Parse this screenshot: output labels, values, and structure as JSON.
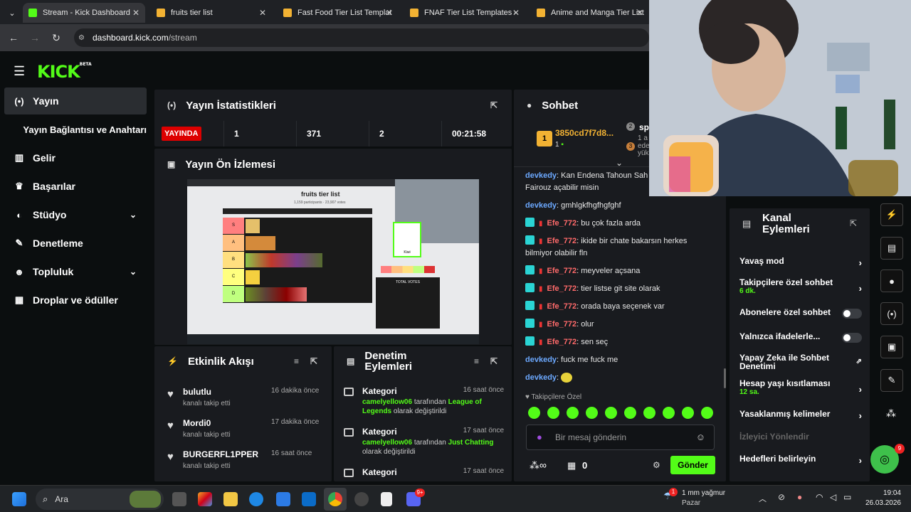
{
  "browser": {
    "tabs": [
      {
        "title": "Stream - Kick Dashboard",
        "active": true
      },
      {
        "title": "fruits tier list"
      },
      {
        "title": "Fast Food Tier List Templat"
      },
      {
        "title": "FNAF Tier List Templates -"
      },
      {
        "title": "Anime and Manga Tier List"
      }
    ],
    "url_domain": "dashboard.kick.com",
    "url_path": "/stream"
  },
  "brand": {
    "logo": "KICK",
    "beta": "BETA",
    "accent": "#53fc18"
  },
  "sidebar": {
    "items": [
      {
        "label": "Yayın",
        "icon": "broadcast-icon",
        "active": true
      },
      {
        "label": "Yayın Bağlantısı ve Anahtarı"
      },
      {
        "label": "Gelir",
        "icon": "chart-icon"
      },
      {
        "label": "Başarılar",
        "icon": "trophy-icon"
      },
      {
        "label": "Stüdyo",
        "icon": "palette-icon",
        "chevron": true
      },
      {
        "label": "Denetleme",
        "icon": "wrench-icon"
      },
      {
        "label": "Topluluk",
        "icon": "people-icon",
        "chevron": true
      },
      {
        "label": "Droplar ve ödüller",
        "icon": "gift-icon"
      }
    ]
  },
  "stats": {
    "title": "Yayın İstatistikleri",
    "live": "YAYINDA",
    "values": [
      "1",
      "371",
      "2",
      "00:21:58"
    ]
  },
  "preview": {
    "title": "Yayın Ön İzlemesi",
    "screen_title": "fruits tier list",
    "screen_sub": "1,159 participants · 23,907 votes",
    "tiers": [
      "S",
      "A",
      "B",
      "C",
      "D"
    ],
    "side_label": "Kiwi",
    "total_votes": "TOTAL VOTES"
  },
  "activity": {
    "title": "Etkinlik Akışı",
    "items": [
      {
        "name": "bulutlu",
        "desc": "kanalı takip etti",
        "time": "16 dakika önce"
      },
      {
        "name": "Mordi0",
        "desc": "kanalı takip etti",
        "time": "17 dakika önce"
      },
      {
        "name": "BURGERFL1PPER",
        "desc": "kanalı takip etti",
        "time": "16 saat önce"
      }
    ]
  },
  "moderation": {
    "title": "Denetim Eylemleri",
    "items": [
      {
        "title": "Kategori",
        "user": "camelyellow06",
        "mid": " tarafından ",
        "target": "League of Legends",
        "end": " olarak değiştirildi",
        "time": "16 saat önce"
      },
      {
        "title": "Kategori",
        "user": "camelyellow06",
        "mid": " tarafından ",
        "target": "Just Chatting",
        "end": " olarak değiştirildi",
        "time": "17 saat önce"
      },
      {
        "title": "Kategori",
        "time": "17 saat önce"
      }
    ]
  },
  "chat": {
    "title": "Sohbet",
    "top1": {
      "name": "3850cd7f7d8...",
      "count": "1",
      "rank": "1"
    },
    "top2": {
      "name": "sp",
      "line1": "1 a",
      "line2": "ede",
      "line3": "yük",
      "rank2": "2",
      "rank3": "3"
    },
    "messages": [
      {
        "user": "devkedy",
        "text": "Kan Endena Tahoun Sah Fairouz açabilir misin",
        "color": "#6ca9ff"
      },
      {
        "user": "devkedy",
        "text": "gmhlgkfhgfhgfghf",
        "color": "#6ca9ff"
      },
      {
        "user": "Efe_772",
        "text": "bu çok fazla arda",
        "color": "#ff6a6a",
        "badge": true
      },
      {
        "user": "Efe_772",
        "text": "ikide bir chate bakarsın herkes bilmiyor olabilir fln",
        "color": "#ff6a6a",
        "badge": true
      },
      {
        "user": "Efe_772",
        "text": "meyveler açsana",
        "color": "#ff6a6a",
        "badge": true
      },
      {
        "user": "Efe_772",
        "text": "tier listse git site olarak",
        "color": "#ff6a6a",
        "badge": true
      },
      {
        "user": "Efe_772",
        "text": "orada baya seçenek var",
        "color": "#ff6a6a",
        "badge": true
      },
      {
        "user": "Efe_772",
        "text": "olur",
        "color": "#ff6a6a",
        "badge": true
      },
      {
        "user": "Efe_772",
        "text": "sen seç",
        "color": "#ff6a6a",
        "badge": true
      },
      {
        "user": "devkedy",
        "text": "fuck me fuck me",
        "color": "#6ca9ff"
      },
      {
        "user": "devkedy",
        "text": "",
        "color": "#6ca9ff"
      }
    ],
    "followers_only": "Takipçilere Özel",
    "placeholder": "Bir mesaj gönderin",
    "points": "0",
    "send": "Gönder"
  },
  "channel": {
    "title_1": "Kanal",
    "title_2": "Eylemleri",
    "rows": [
      {
        "label": "Yavaş mod",
        "type": "arrow"
      },
      {
        "label": "Takipçilere özel sohbet",
        "sub": "6 dk.",
        "type": "arrow"
      },
      {
        "label": "Abonelere özel sohbet",
        "type": "toggle"
      },
      {
        "label": "Yalnızca ifadelerle...",
        "type": "toggle"
      },
      {
        "label": "Yapay Zeka ile Sohbet Denetimi",
        "type": "ext"
      },
      {
        "label": "Hesap yaşı kısıtlaması",
        "sub": "12 sa.",
        "type": "arrow"
      },
      {
        "label": "Yasaklanmış kelimeler",
        "type": "arrow"
      },
      {
        "label": "İzleyici Yönlendir",
        "type": "disabled"
      },
      {
        "label": "Hedefleri belirleyin",
        "type": "arrow"
      }
    ]
  },
  "help_badge": "9",
  "taskbar": {
    "search": "Ara",
    "weather_line1": "1 mm yağmur",
    "weather_line2": "Pazar",
    "weather_badge": "1",
    "time": "19:04",
    "date": "26.03.2026",
    "discord_badge": "9+"
  }
}
